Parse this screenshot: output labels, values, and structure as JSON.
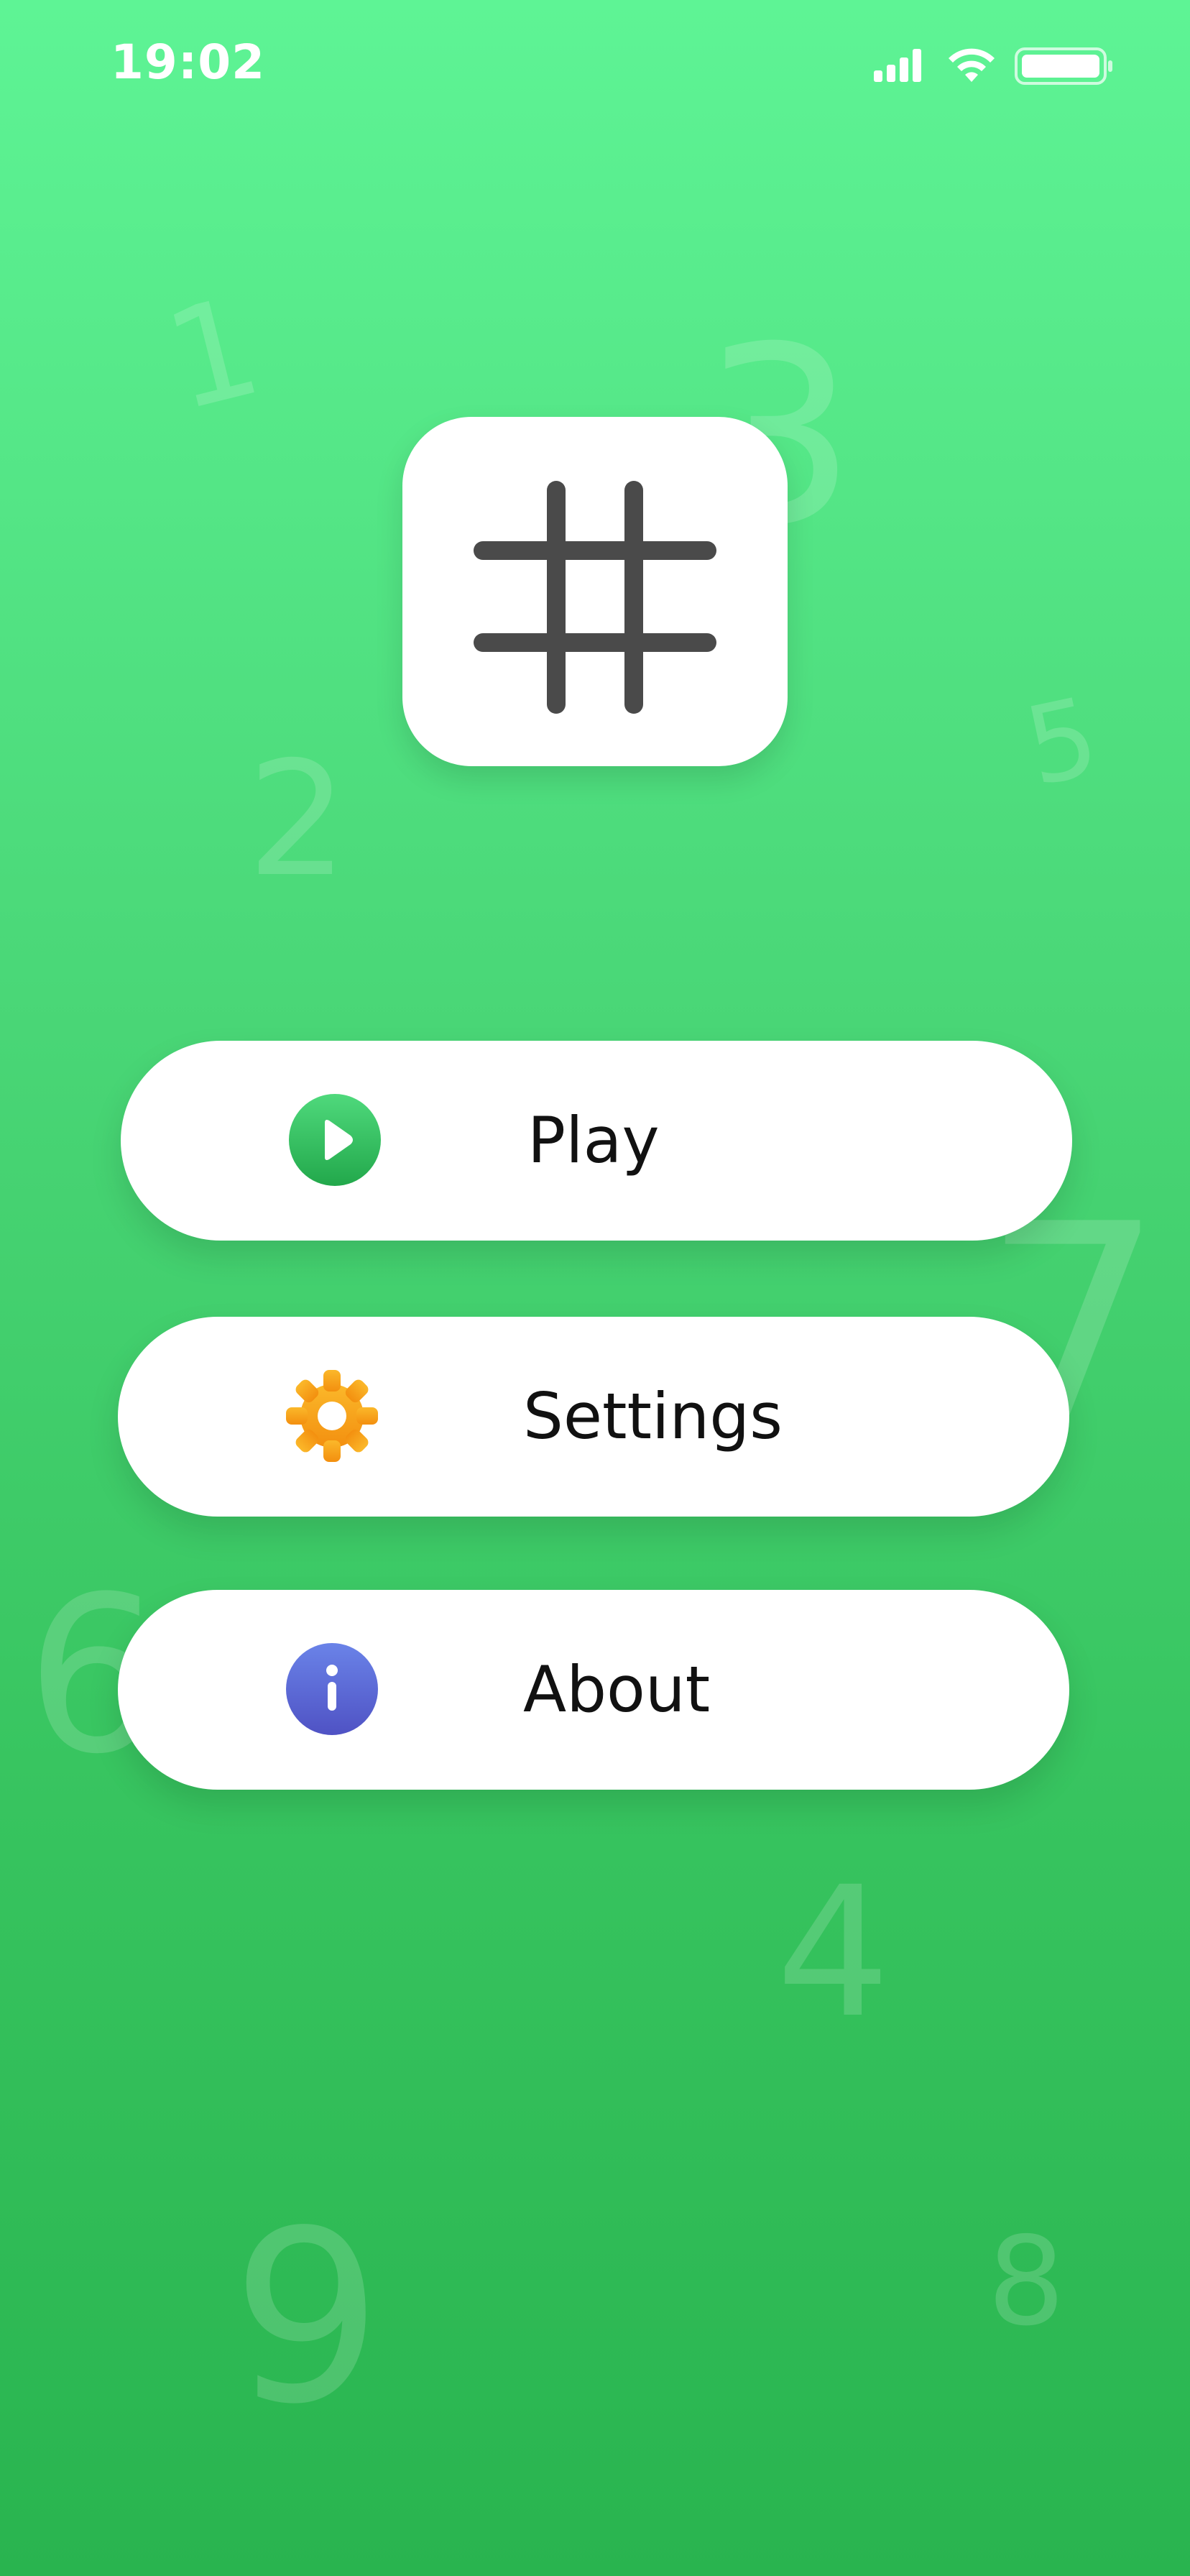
{
  "status_bar": {
    "time": "19:02",
    "icons": [
      "cellular-signal-icon",
      "wifi-icon",
      "battery-icon"
    ]
  },
  "background_digits": [
    "1",
    "2",
    "3",
    "5",
    "7",
    "6",
    "4",
    "9",
    "8"
  ],
  "logo": {
    "icon": "hash-grid-icon"
  },
  "menu": {
    "play": {
      "label": "Play",
      "icon": "play-icon",
      "icon_color": "#2fbf5a"
    },
    "settings": {
      "label": "Settings",
      "icon": "gear-icon",
      "icon_color": "#f7a11a"
    },
    "about": {
      "label": "About",
      "icon": "info-icon",
      "icon_color": "#5b6bd6"
    }
  },
  "colors": {
    "background_top": "#5ef495",
    "background_bottom": "#29b44f",
    "button_bg": "#ffffff",
    "logo_stroke": "#4a4a4a"
  }
}
